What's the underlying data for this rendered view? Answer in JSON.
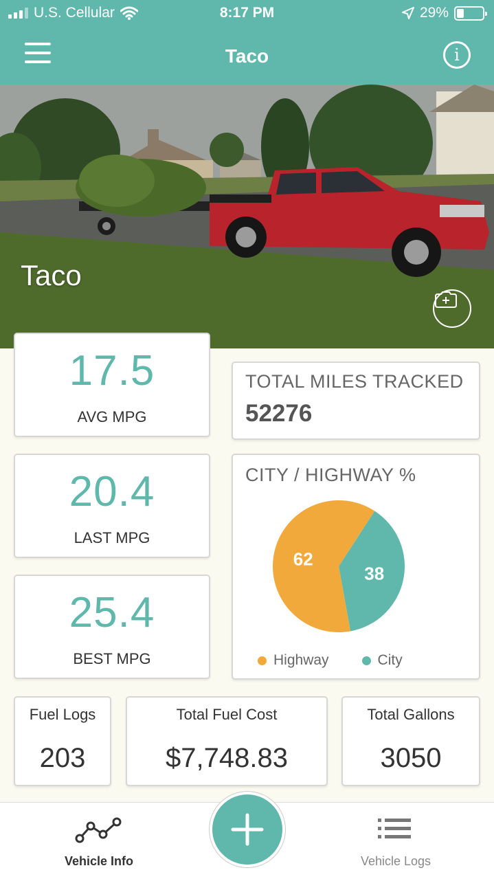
{
  "status_bar": {
    "carrier": "U.S. Cellular",
    "time": "8:17 PM",
    "battery": "29%",
    "battery_level": 0.29,
    "icons": [
      "signal-icon",
      "wifi-icon",
      "location-arrow-icon",
      "battery-icon"
    ]
  },
  "header": {
    "title": "Taco",
    "menu_icon": "hamburger-menu-icon",
    "info_icon": "info-icon",
    "info_glyph": "i"
  },
  "hero": {
    "vehicle_name": "Taco",
    "camera_icon": "camera-add-icon"
  },
  "stats": {
    "avg_mpg": {
      "value": "17.5",
      "label": "AVG MPG"
    },
    "last_mpg": {
      "value": "20.4",
      "label": "LAST MPG"
    },
    "best_mpg": {
      "value": "25.4",
      "label": "BEST MPG"
    },
    "total_miles": {
      "label": "TOTAL MILES TRACKED",
      "value": "52276"
    },
    "fuel_logs": {
      "label": "Fuel Logs",
      "value": "203"
    },
    "total_fuel_cost": {
      "label": "Total Fuel Cost",
      "value": "$7,748.83"
    },
    "total_gallons": {
      "label": "Total Gallons",
      "value": "3050"
    }
  },
  "split": {
    "title": "CITY / HIGHWAY %",
    "segments": [
      {
        "name": "Highway",
        "value": 62,
        "color": "#f2a93b"
      },
      {
        "name": "City",
        "value": 38,
        "color": "#5fb8ab"
      }
    ]
  },
  "tabbar": {
    "vehicle_info": {
      "label": "Vehicle Info",
      "icon": "line-graph-icon"
    },
    "add": {
      "icon": "plus-icon"
    },
    "vehicle_logs": {
      "label": "Vehicle Logs",
      "icon": "list-icon"
    }
  },
  "colors": {
    "accent": "#5fb8ab",
    "highway": "#f2a93b",
    "background": "#fbfaf0"
  }
}
